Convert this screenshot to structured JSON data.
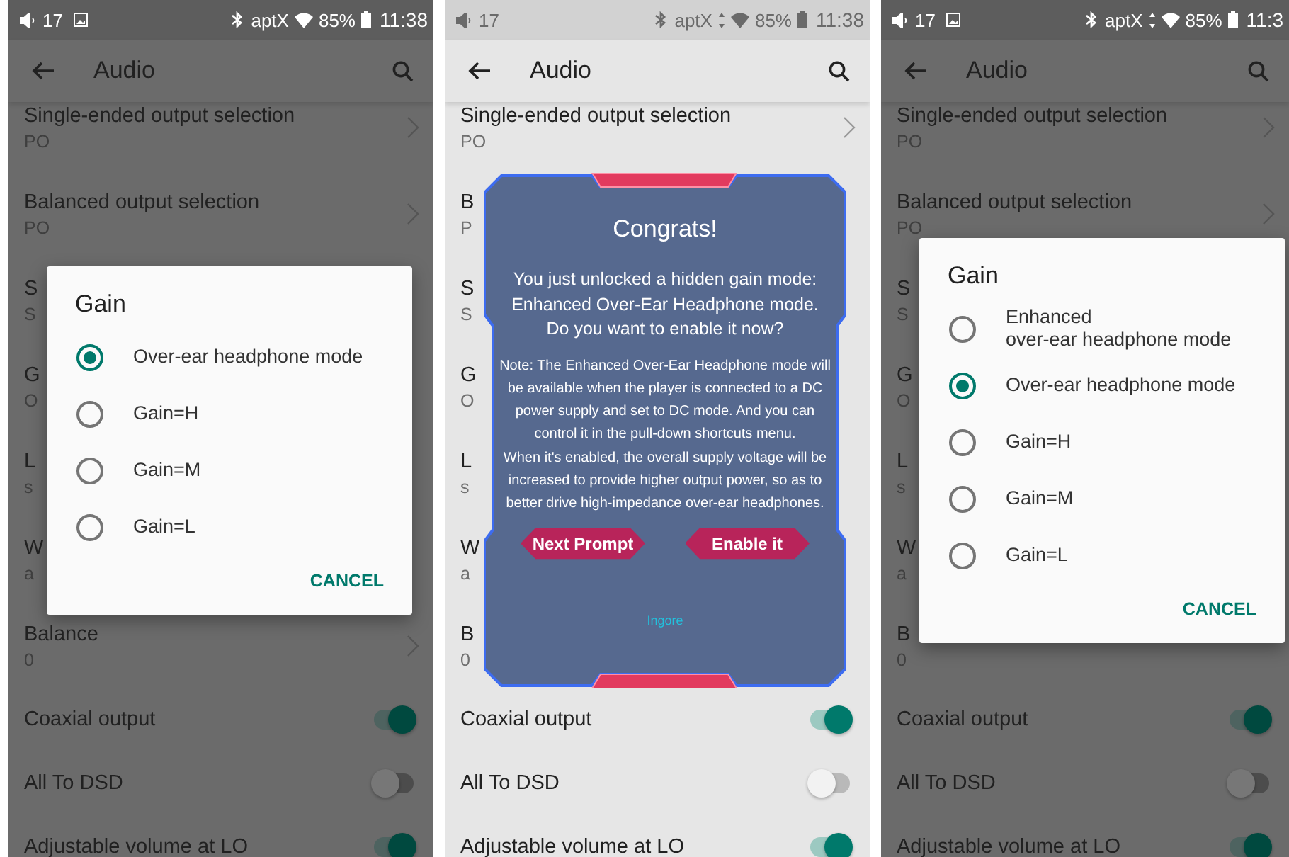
{
  "screens": [
    {
      "dimmed": true,
      "status": {
        "volume": "17",
        "image_icon": true,
        "codec": "aptX",
        "data_arrows": false,
        "battery": "85%",
        "time": "11:38"
      },
      "title": "Audio",
      "items": [
        {
          "kind": "link",
          "title": "Single-ended output selection",
          "subtitle": "PO"
        },
        {
          "kind": "link",
          "title": "Balanced output selection",
          "subtitle": "PO"
        },
        {
          "kind": "covered",
          "title": "S",
          "subtitle": "S"
        },
        {
          "kind": "covered",
          "title": "G",
          "subtitle": "O"
        },
        {
          "kind": "covered",
          "title": "L",
          "subtitle": "s"
        },
        {
          "kind": "covered",
          "title": "W",
          "subtitle": "a"
        },
        {
          "kind": "link",
          "title": "Balance",
          "subtitle": "0"
        },
        {
          "kind": "toggle",
          "title": "Coaxial output",
          "on": true
        },
        {
          "kind": "toggle",
          "title": "All To DSD",
          "on": false
        },
        {
          "kind": "toggle",
          "title": "Adjustable volume at LO",
          "on": true
        }
      ],
      "dialog": {
        "kind": "radio",
        "title": "Gain",
        "options": [
          {
            "label": "Over-ear headphone mode",
            "selected": true
          },
          {
            "label": "Gain=H",
            "selected": false
          },
          {
            "label": "Gain=M",
            "selected": false
          },
          {
            "label": "Gain=L",
            "selected": false
          }
        ],
        "button": "CANCEL"
      }
    },
    {
      "dimmed": false,
      "status": {
        "volume": "17",
        "image_icon": false,
        "codec": "aptX",
        "data_arrows": true,
        "battery": "85%",
        "time": "11:38"
      },
      "title": "Audio",
      "items": [
        {
          "kind": "link",
          "title": "Single-ended output selection",
          "subtitle": "PO"
        },
        {
          "kind": "covered",
          "title": "B",
          "subtitle": "P"
        },
        {
          "kind": "covered",
          "title": "S",
          "subtitle": "S"
        },
        {
          "kind": "covered",
          "title": "G",
          "subtitle": "O"
        },
        {
          "kind": "covered",
          "title": "L",
          "subtitle": "s"
        },
        {
          "kind": "covered",
          "title": "W",
          "subtitle": "a"
        },
        {
          "kind": "covered",
          "title": "B",
          "subtitle": "0"
        },
        {
          "kind": "toggle",
          "title": "Coaxial output",
          "on": true
        },
        {
          "kind": "toggle",
          "title": "All To DSD",
          "on": false
        },
        {
          "kind": "toggle",
          "title": "Adjustable volume at LO",
          "on": true
        }
      ],
      "dialog": {
        "kind": "promo",
        "title": "Congrats!",
        "message": "You just unlocked a hidden gain mode: Enhanced Over-Ear Headphone mode. Do you want to enable it now?",
        "note": "Note: The Enhanced Over-Ear Headphone mode will be available when the player is connected to a DC power supply and set to DC mode. And you can control it in the pull-down shortcuts menu.\nWhen it's enabled, the overall supply voltage will be increased to provide higher output power, so as to better drive high-impedance over-ear headphones.",
        "buttons": [
          "Next Prompt",
          "Enable it"
        ],
        "link": "Ingore"
      }
    },
    {
      "dimmed": true,
      "status": {
        "volume": "17",
        "image_icon": true,
        "codec": "aptX",
        "data_arrows": true,
        "battery": "85%",
        "time": "11:3"
      },
      "title": "Audio",
      "items": [
        {
          "kind": "link",
          "title": "Single-ended output selection",
          "subtitle": "PO"
        },
        {
          "kind": "link",
          "title": "Balanced output selection",
          "subtitle": "PO"
        },
        {
          "kind": "covered",
          "title": "S",
          "subtitle": "S"
        },
        {
          "kind": "covered",
          "title": "G",
          "subtitle": "O"
        },
        {
          "kind": "covered",
          "title": "L",
          "subtitle": "s"
        },
        {
          "kind": "covered",
          "title": "W",
          "subtitle": "a"
        },
        {
          "kind": "covered",
          "title": "B",
          "subtitle": "0"
        },
        {
          "kind": "toggle",
          "title": "Coaxial output",
          "on": true
        },
        {
          "kind": "toggle",
          "title": "All To DSD",
          "on": false
        },
        {
          "kind": "toggle",
          "title": "Adjustable volume at LO",
          "on": true
        }
      ],
      "dialog": {
        "kind": "radio",
        "title": "Gain",
        "options": [
          {
            "label": "Enhanced\nover-ear headphone mode",
            "selected": false
          },
          {
            "label": "Over-ear headphone mode",
            "selected": true
          },
          {
            "label": "Gain=H",
            "selected": false
          },
          {
            "label": "Gain=M",
            "selected": false
          },
          {
            "label": "Gain=L",
            "selected": false
          }
        ],
        "button": "CANCEL"
      }
    }
  ]
}
